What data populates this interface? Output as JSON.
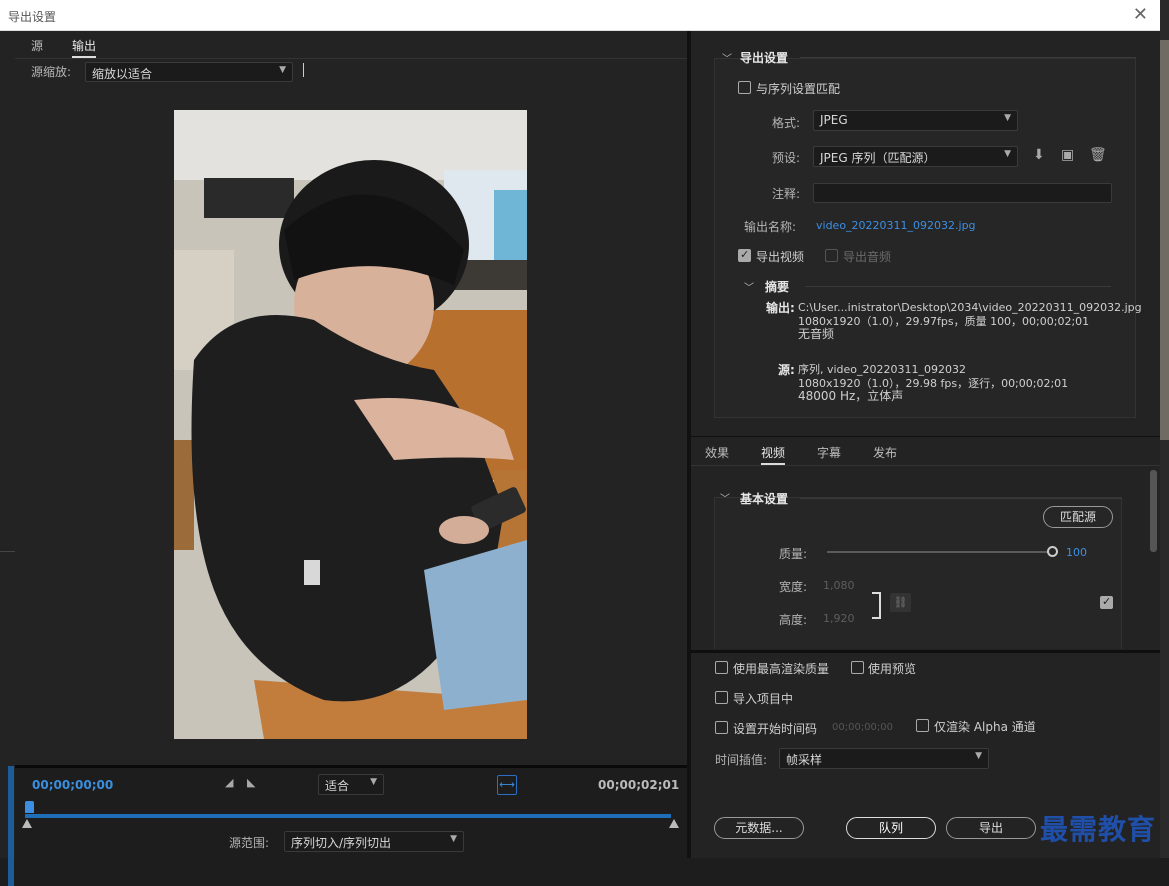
{
  "window": {
    "title": "导出设置",
    "close": "✕"
  },
  "left": {
    "tabs": [
      {
        "label": "源"
      },
      {
        "label": "输出"
      }
    ],
    "scale_label": "源缩放:",
    "scale_value": "缩放以适合",
    "timeline": {
      "start_time": "00;00;00;00",
      "end_time": "00;00;02;01",
      "fit_value": "适合",
      "range_label": "源范围:",
      "range_value": "序列切入/序列切出"
    }
  },
  "export": {
    "section_title": "导出设置",
    "match_sequence": "与序列设置匹配",
    "format_label": "格式:",
    "format_value": "JPEG",
    "preset_label": "预设:",
    "preset_value": "JPEG 序列（匹配源）",
    "comment_label": "注释:",
    "comment_value": "",
    "output_name_label": "输出名称:",
    "output_name_value": "video_20220311_092032.jpg",
    "export_video": "导出视频",
    "export_audio": "导出音频",
    "summary_title": "摘要",
    "summary": {
      "output_label": "输出:",
      "output_lines": [
        "C:\\User...inistrator\\Desktop\\2034\\video_20220311_092032.jpg",
        "1080x1920（1.0），29.97fps，质量 100，00;00;02;01",
        "无音频"
      ],
      "source_label": "源:",
      "source_lines": [
        "序列, video_20220311_092032",
        "1080x1920（1.0），29.98 fps，逐行，00;00;02;01",
        "48000 Hz，立体声"
      ]
    }
  },
  "tabs2": [
    {
      "label": "效果"
    },
    {
      "label": "视频"
    },
    {
      "label": "字幕"
    },
    {
      "label": "发布"
    }
  ],
  "basic": {
    "title": "基本设置",
    "match_source": "匹配源",
    "quality_label": "质量:",
    "quality_value": "100",
    "quality": 1.0,
    "width_label": "宽度:",
    "width_value": "1,080",
    "height_label": "高度:",
    "height_value": "1,920"
  },
  "options": {
    "max_render": "使用最高渲染质量",
    "use_preview": "使用预览",
    "import_project": "导入项目中",
    "set_start_tc": "设置开始时间码",
    "start_tc_value": "00;00;00;00",
    "render_alpha": "仅渲染 Alpha 通道",
    "interp_label": "时间插值:",
    "interp_value": "帧采样"
  },
  "buttons": {
    "metadata": "元数据...",
    "queue": "队列",
    "export": "导出"
  },
  "watermark": "最需教育",
  "colors": {
    "accent": "#3c8fe3",
    "bg": "#232323"
  }
}
